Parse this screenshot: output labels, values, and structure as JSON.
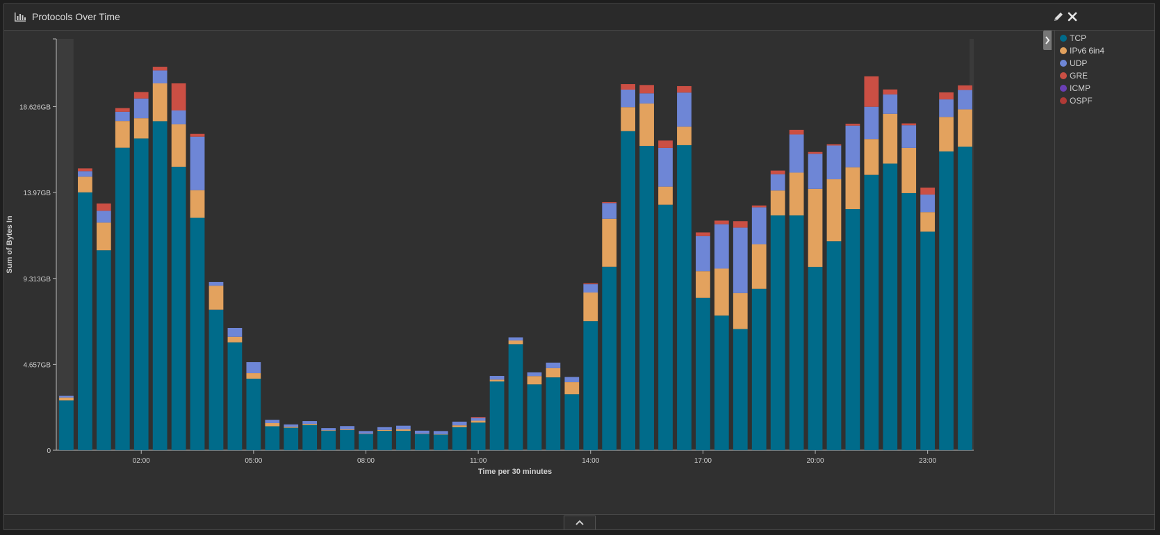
{
  "panel": {
    "title": "Protocols Over Time"
  },
  "icons": {
    "title": "bar-chart-icon",
    "edit": "pencil-icon",
    "close": "close-icon",
    "collapse": "chevron-right-icon",
    "footer": "chevron-up-icon"
  },
  "colors": {
    "background": "#303030",
    "axis": "#bbbbbb"
  },
  "chart_data": {
    "type": "bar",
    "stacked": true,
    "xlabel": "Time per 30 minutes",
    "ylabel": "Sum of Bytes In",
    "yticks": [
      {
        "value": 0,
        "label": "0"
      },
      {
        "value": 4.657,
        "label": "4.657GB"
      },
      {
        "value": 9.313,
        "label": "9.313GB"
      },
      {
        "value": 13.97,
        "label": "13.97GB"
      },
      {
        "value": 18.626,
        "label": "18.626GB"
      }
    ],
    "ylim": [
      0,
      22.3
    ],
    "xticks": [
      {
        "index": 4,
        "label": "02:00"
      },
      {
        "index": 10,
        "label": "05:00"
      },
      {
        "index": 16,
        "label": "08:00"
      },
      {
        "index": 22,
        "label": "11:00"
      },
      {
        "index": 28,
        "label": "14:00"
      },
      {
        "index": 34,
        "label": "17:00"
      },
      {
        "index": 40,
        "label": "20:00"
      },
      {
        "index": 46,
        "label": "23:00"
      }
    ],
    "legend_position": "right",
    "series": [
      {
        "name": "TCP",
        "color": "#006b8a",
        "values": [
          2.7,
          13.98,
          10.84,
          16.4,
          16.9,
          17.84,
          15.37,
          12.6,
          7.62,
          5.85,
          3.88,
          1.3,
          1.22,
          1.37,
          1.05,
          1.1,
          0.88,
          1.05,
          1.05,
          0.88,
          0.85,
          1.25,
          1.5,
          3.73,
          5.75,
          3.57,
          3.95,
          3.04,
          7.0,
          9.95,
          17.3,
          16.5,
          13.31,
          16.54,
          8.26,
          7.3,
          6.57,
          8.75,
          12.73,
          12.73,
          9.94,
          11.33,
          13.07,
          14.93,
          15.54,
          13.94,
          11.85,
          16.2,
          16.46
        ]
      },
      {
        "name": "IPv6 6in4",
        "color": "#e3a25e",
        "values": [
          0.15,
          0.85,
          1.5,
          1.45,
          1.1,
          2.05,
          2.3,
          1.5,
          1.3,
          0.3,
          0.3,
          0.17,
          0.05,
          0.06,
          0.03,
          0.03,
          0.02,
          0.05,
          0.08,
          0.02,
          0.02,
          0.1,
          0.1,
          0.1,
          0.2,
          0.45,
          0.5,
          0.65,
          1.55,
          2.6,
          1.3,
          2.3,
          0.98,
          1.0,
          1.45,
          2.55,
          1.95,
          2.42,
          1.35,
          2.32,
          4.23,
          3.36,
          2.27,
          1.94,
          2.7,
          2.45,
          1.06,
          1.87,
          2.02
        ]
      },
      {
        "name": "UDP",
        "color": "#6e86d6",
        "values": [
          0.1,
          0.3,
          0.64,
          0.5,
          1.07,
          0.7,
          0.75,
          2.9,
          0.2,
          0.48,
          0.6,
          0.18,
          0.13,
          0.15,
          0.12,
          0.18,
          0.14,
          0.15,
          0.2,
          0.16,
          0.17,
          0.2,
          0.15,
          0.2,
          0.17,
          0.2,
          0.3,
          0.28,
          0.45,
          0.85,
          0.95,
          0.55,
          2.1,
          1.85,
          1.9,
          2.4,
          3.55,
          2.0,
          0.88,
          2.07,
          1.9,
          1.83,
          2.26,
          1.75,
          1.05,
          1.23,
          0.95,
          0.95,
          1.05
        ]
      },
      {
        "name": "GRE",
        "color": "#cb4f44",
        "values": [
          0,
          0.15,
          0.4,
          0.2,
          0.35,
          0.2,
          1.47,
          0.15,
          0,
          0,
          0,
          0,
          0,
          0,
          0,
          0,
          0,
          0,
          0,
          0,
          0,
          0,
          0.05,
          0,
          0,
          0,
          0,
          0,
          0.05,
          0.05,
          0.3,
          0.45,
          0.4,
          0.35,
          0.2,
          0.2,
          0.35,
          0.1,
          0.2,
          0.25,
          0.1,
          0.07,
          0.1,
          1.65,
          0.27,
          0.1,
          0.38,
          0.38,
          0.25
        ]
      },
      {
        "name": "ICMP",
        "color": "#6a3fb5",
        "values": [
          0,
          0,
          0,
          0,
          0,
          0,
          0,
          0,
          0,
          0,
          0,
          0,
          0,
          0,
          0,
          0,
          0,
          0,
          0,
          0,
          0,
          0,
          0,
          0,
          0,
          0,
          0,
          0,
          0,
          0,
          0,
          0,
          0,
          0,
          0,
          0,
          0,
          0,
          0,
          0,
          0,
          0,
          0,
          0,
          0,
          0,
          0,
          0,
          0
        ]
      },
      {
        "name": "OSPF",
        "color": "#b03a36",
        "values": [
          0,
          0,
          0,
          0,
          0,
          0,
          0,
          0,
          0,
          0,
          0,
          0,
          0,
          0,
          0,
          0,
          0,
          0,
          0,
          0,
          0,
          0,
          0,
          0,
          0,
          0,
          0,
          0,
          0,
          0,
          0,
          0,
          0,
          0,
          0,
          0,
          0,
          0,
          0,
          0,
          0,
          0,
          0,
          0,
          0,
          0,
          0,
          0,
          0
        ]
      }
    ]
  }
}
